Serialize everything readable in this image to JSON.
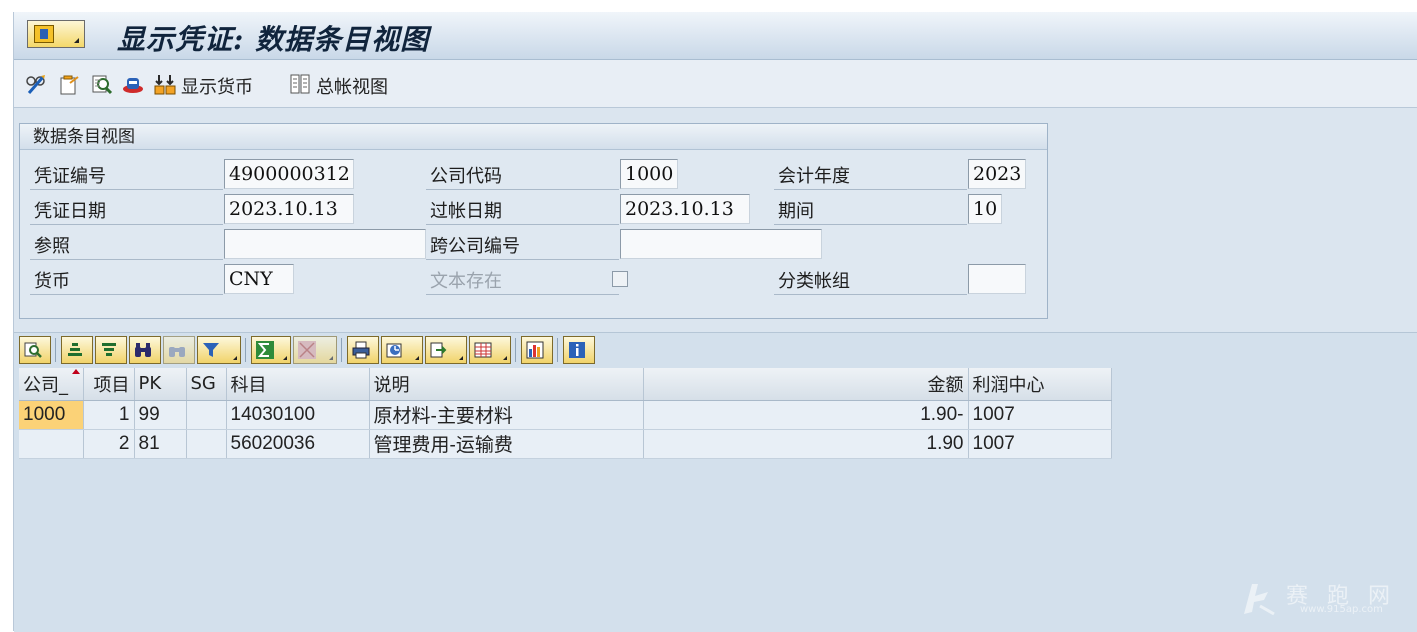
{
  "title": "显示凭证: 数据条目视图",
  "toolbar": {
    "display_currency": "显示货币",
    "gl_view": "总帐视图"
  },
  "header": {
    "section_title": "数据条目视图",
    "doc_number_label": "凭证编号",
    "doc_number": "4900000312",
    "company_code_label": "公司代码",
    "company_code": "1000",
    "fiscal_year_label": "会计年度",
    "fiscal_year": "2023",
    "doc_date_label": "凭证日期",
    "doc_date": "2023.10.13",
    "posting_date_label": "过帐日期",
    "posting_date": "2023.10.13",
    "period_label": "期间",
    "period": "10",
    "reference_label": "参照",
    "reference": "",
    "cross_company_label": "跨公司编号",
    "cross_company": "",
    "currency_label": "货币",
    "currency": "CNY",
    "text_exists_label": "文本存在",
    "ledger_group_label": "分类帐组",
    "ledger_group": ""
  },
  "grid": {
    "columns": [
      "公司_",
      "项目",
      "PK",
      "SG",
      "科目",
      "说明",
      "金额",
      "利润中心"
    ],
    "rows": [
      {
        "company": "1000",
        "item": "1",
        "pk": "99",
        "sg": "",
        "account": "14030100",
        "desc": "原材料-主要材料",
        "amount": "1.90-",
        "profit_center": "1007"
      },
      {
        "company": "",
        "item": "2",
        "pk": "81",
        "sg": "",
        "account": "56020036",
        "desc": "管理费用-运输费",
        "amount": "1.90",
        "profit_center": "1007"
      }
    ]
  },
  "watermark": {
    "text": "赛 跑 网",
    "url": "www.915ap.com"
  },
  "colors": {
    "frame_bg": "#dbe5ef",
    "button_yellow": "#f1d36a",
    "key_cell": "#fbd277",
    "title_text": "#10243c"
  }
}
